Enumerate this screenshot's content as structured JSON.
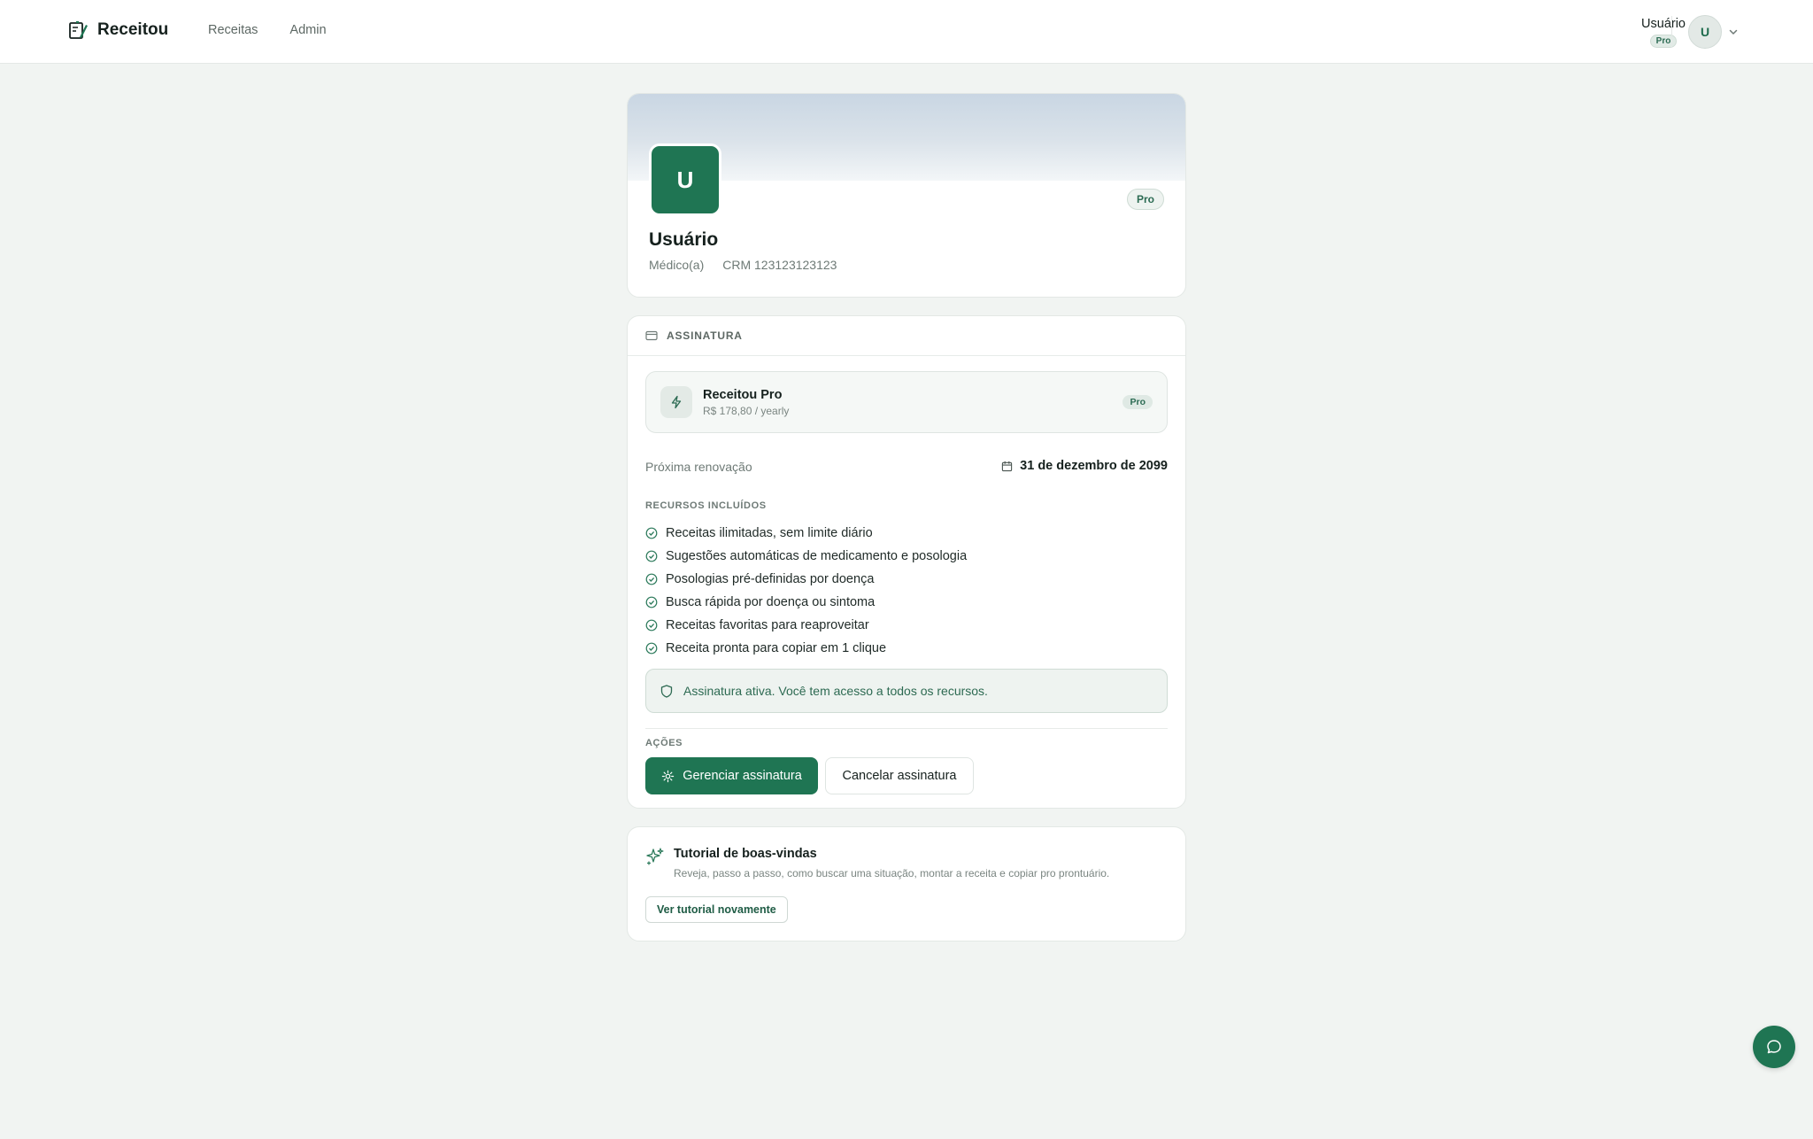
{
  "header": {
    "brand": "Receitou",
    "nav": [
      {
        "label": "Receitas"
      },
      {
        "label": "Admin"
      }
    ],
    "user": {
      "name": "Usuário",
      "badge": "Pro",
      "initial": "U"
    }
  },
  "profile": {
    "initial": "U",
    "badge": "Pro",
    "name": "Usuário",
    "role": "Médico(a)",
    "crm": "CRM 123123123123"
  },
  "subscription": {
    "section_title": "ASSINATURA",
    "plan": {
      "name": "Receitou Pro",
      "price": "R$ 178,80 / yearly",
      "badge": "Pro"
    },
    "renewal_label": "Próxima renovação",
    "renewal_date": "31 de dezembro de 2099",
    "resources_title": "RECURSOS INCLUÍDOS",
    "features": [
      "Receitas ilimitadas, sem limite diário",
      "Sugestões automáticas de medicamento e posologia",
      "Posologias pré-definidas por doença",
      "Busca rápida por doença ou sintoma",
      "Receitas favoritas para reaproveitar",
      "Receita pronta para copiar em 1 clique"
    ],
    "status_message": "Assinatura ativa. Você tem acesso a todos os recursos.",
    "actions_title": "AÇÕES",
    "manage_label": "Gerenciar assinatura",
    "cancel_label": "Cancelar assinatura"
  },
  "tutorial": {
    "title": "Tutorial de boas-vindas",
    "description": "Reveja, passo a passo, como buscar uma situação, montar a receita e copiar pro prontuário.",
    "button": "Ver tutorial novamente"
  },
  "colors": {
    "brand": "#1f7553",
    "background": "#f1f4f2"
  }
}
